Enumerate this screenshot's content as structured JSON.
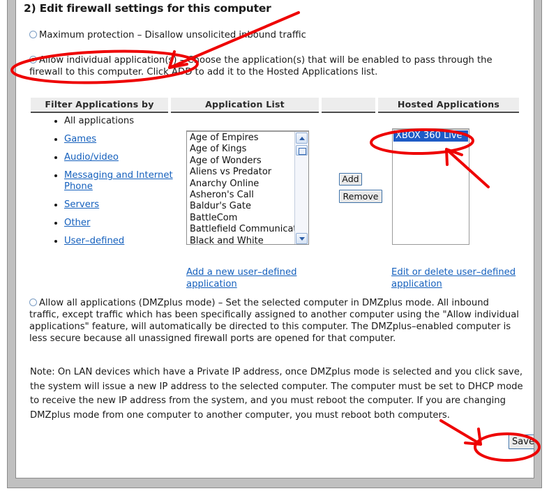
{
  "page": {
    "heading": "2) Edit firewall settings for this computer"
  },
  "options": {
    "maximum_protection": {
      "label": "Maximum protection – Disallow unsolicited inbound traffic",
      "selected": false
    },
    "allow_individual": {
      "label": "Allow individual application(s) – Choose the application(s) that will be enabled to pass through the firewall to this computer. Click ADD to add it to the Hosted Applications list.",
      "selected": true
    },
    "allow_all_dmzplus": {
      "label": "Allow all applications (DMZplus mode) – Set the selected computer in DMZplus mode. All inbound traffic, except traffic which has been specifically assigned to another computer using the \"Allow individual applications\" feature, will automatically be directed to this computer. The DMZplus–enabled computer is less secure because all unassigned firewall ports are opened for that computer.",
      "selected": false
    }
  },
  "table": {
    "headers": [
      "Filter Applications by",
      "Application List",
      "",
      "Hosted Applications"
    ]
  },
  "filters": [
    {
      "label": "All applications",
      "link": false
    },
    {
      "label": "Games",
      "link": true
    },
    {
      "label": "Audio/video",
      "link": true
    },
    {
      "label": "Messaging and Internet Phone",
      "link": true
    },
    {
      "label": "Servers",
      "link": true
    },
    {
      "label": "Other",
      "link": true
    },
    {
      "label": "User–defined",
      "link": true
    }
  ],
  "application_list": {
    "items": [
      "Age of Empires",
      "Age of Kings",
      "Age of Wonders",
      "Aliens vs Predator",
      "Anarchy Online",
      "Asheron's Call",
      "Baldur's Gate",
      "BattleCom",
      "Battlefield Communicator",
      "Black and White"
    ],
    "selected": null
  },
  "buttons": {
    "add": "Add",
    "remove": "Remove",
    "save": "Save"
  },
  "hosted_applications": {
    "items": [
      "XBOX 360 Live"
    ],
    "selected": "XBOX 360 Live"
  },
  "links": {
    "add_user_defined": "Add a new user–defined application",
    "edit_user_defined": "Edit or delete user–defined application"
  },
  "note": {
    "text": "Note: On LAN devices which have a Private IP address, once DMZplus mode is selected and you click save, the system will issue a new IP address to the selected computer. The computer must be set to DHCP mode to receive the new IP address from the system, and you must reboot the computer. If you are changing DMZplus mode from one computer to another computer, you must reboot both computers."
  },
  "annotations": {
    "color": "#ee0000",
    "marks": [
      {
        "type": "ellipse",
        "target": "allow-individual-radio-row"
      },
      {
        "type": "arrow",
        "target": "allow-individual-radio-row"
      },
      {
        "type": "ellipse",
        "target": "hosted-applications-selected-item"
      },
      {
        "type": "arrow",
        "target": "hosted-applications-selected-item"
      },
      {
        "type": "ellipse",
        "target": "save-button"
      },
      {
        "type": "arrow",
        "target": "save-button"
      }
    ]
  },
  "colors": {
    "link": "#1560bd",
    "selection": "#1e5bc6",
    "header_bg": "#ededed",
    "frame": "#c0c0c0",
    "annotation": "#ee0000",
    "radio_on": "#1aa81a"
  }
}
